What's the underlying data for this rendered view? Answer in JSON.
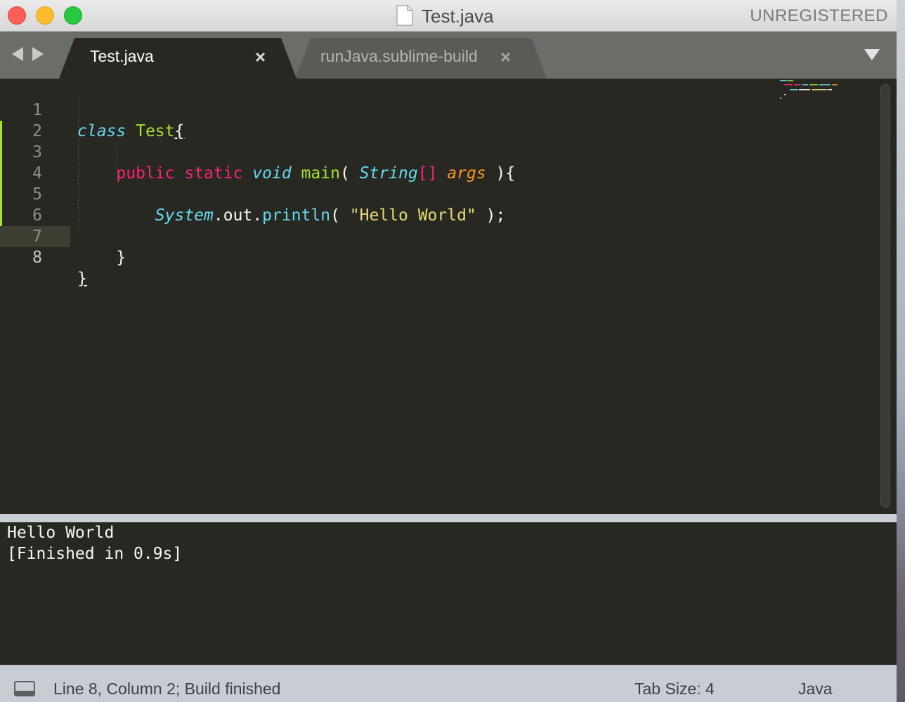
{
  "window": {
    "title": "Test.java",
    "registration": "UNREGISTERED"
  },
  "tabs": [
    {
      "label": "Test.java",
      "active": true
    },
    {
      "label": "runJava.sublime-build",
      "active": false
    }
  ],
  "tab_close_glyph": "×",
  "editor": {
    "current_line": 8,
    "line_numbers": [
      "1",
      "2",
      "3",
      "4",
      "5",
      "6",
      "7",
      "8"
    ],
    "code": {
      "l1": {
        "kw": "class",
        "name": "Test",
        "brace": "{"
      },
      "l3": {
        "public": "public",
        "static": "static",
        "void": "void",
        "main": "main",
        "open": "( ",
        "type": "String",
        "brackets": "[]",
        "args": "args",
        "close": " ){"
      },
      "l5": {
        "system": "System",
        "dot1": ".",
        "out": "out",
        "dot2": ".",
        "println": "println",
        "open": "( ",
        "str": "\"Hello World\"",
        "close": " );"
      },
      "l7": {
        "brace": "}"
      },
      "l8": {
        "brace": "}"
      }
    }
  },
  "output": {
    "lines": [
      "Hello World",
      "[Finished in 0.9s]"
    ]
  },
  "status": {
    "position": "Line 8, Column 2; Build finished",
    "tab_size": "Tab Size: 4",
    "syntax": "Java"
  },
  "colors": {
    "background": "#272822",
    "keyword": "#f92672",
    "type": "#66d9ef",
    "function": "#a6e22e",
    "param": "#fd971f",
    "string": "#e6db74"
  },
  "icons": {
    "doc": "document-icon",
    "back": "back-arrow-icon",
    "forward": "forward-arrow-icon",
    "tab_menu": "tab-menu-icon",
    "panel": "panel-toggle-icon"
  }
}
